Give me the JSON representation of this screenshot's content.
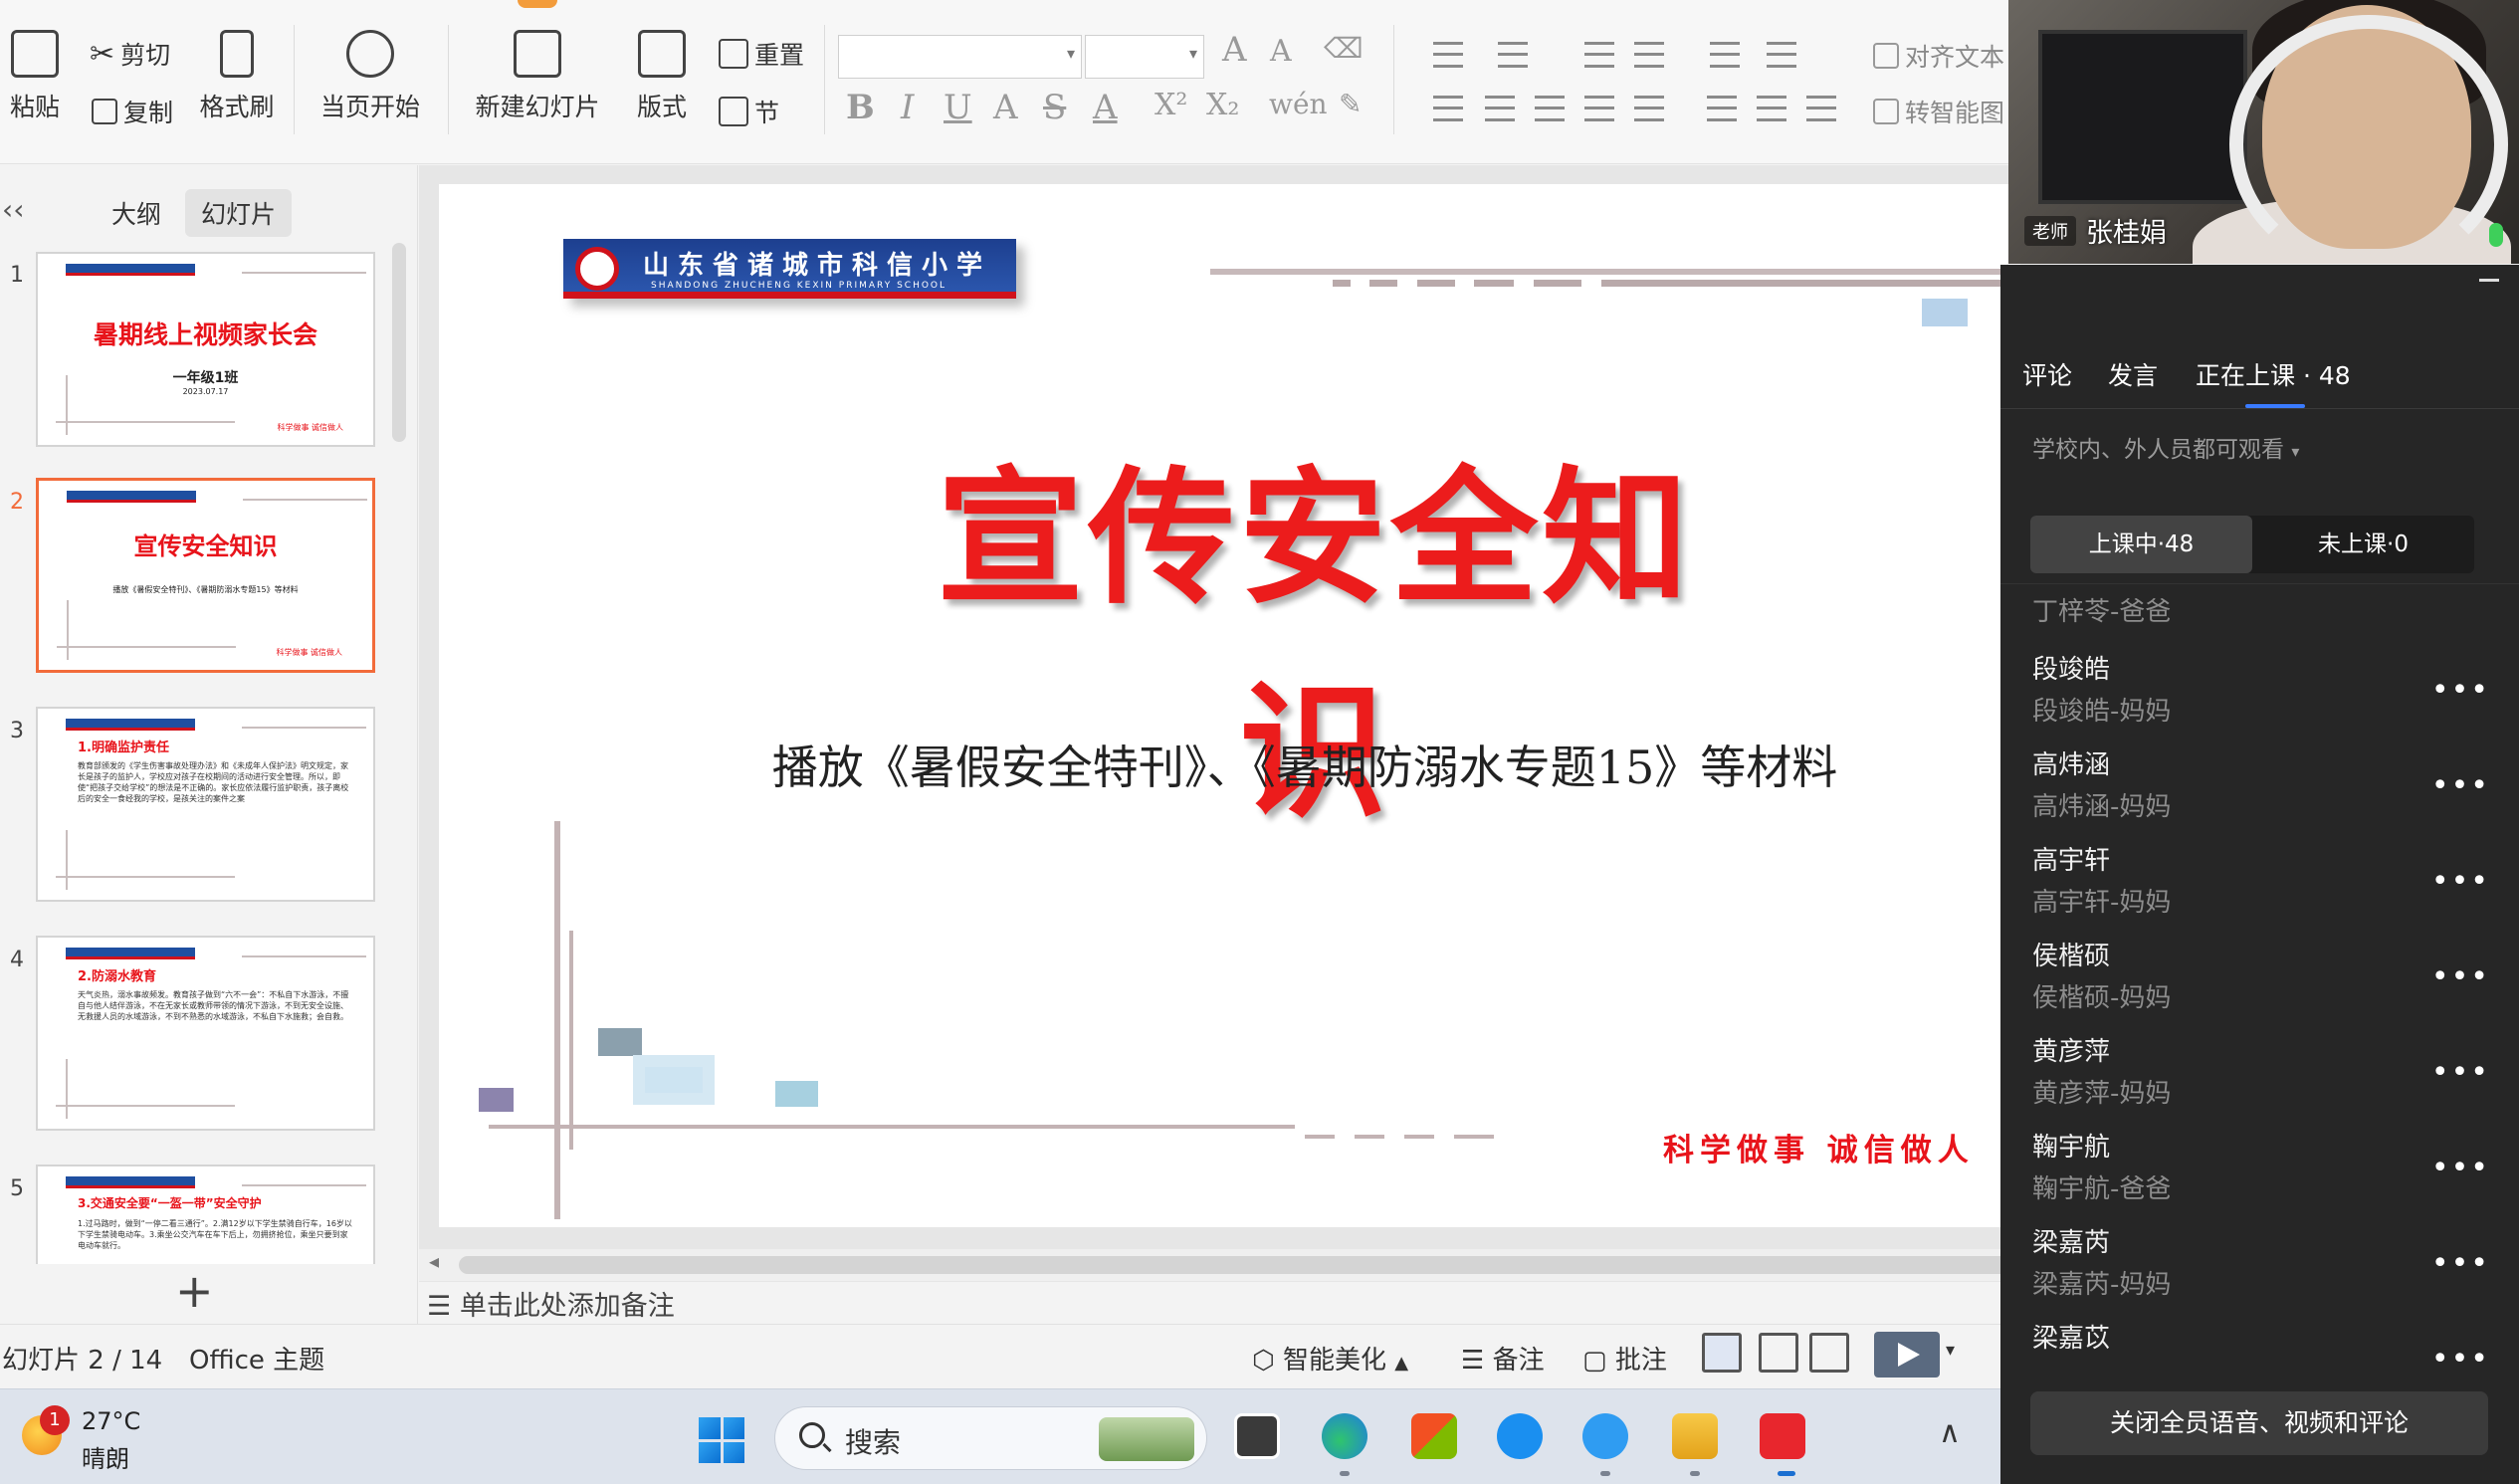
{
  "ribbon": {
    "paste": "粘贴",
    "cut": "剪切",
    "copy": "复制",
    "format_painter": "格式刷",
    "from_current": "当页开始",
    "new_slide": "新建幻灯片",
    "layout": "版式",
    "reset": "重置",
    "section": "节",
    "align_text": "对齐文本",
    "convert_smartart": "转智能图"
  },
  "left_panel": {
    "tab_outline": "大纲",
    "tab_slides": "幻灯片",
    "thumbnails": [
      {
        "num": "1",
        "title": "暑期线上视频家长会",
        "class_name": "一年级1班",
        "date": "2023.07.17",
        "footer": "科学做事  诚信做人"
      },
      {
        "num": "2",
        "title": "宣传安全知识",
        "sub": "播放《暑假安全特刊》、《暑期防溺水专题15》等材料",
        "footer": "科学做事  诚信做人"
      },
      {
        "num": "3",
        "title": "1.明确监护责任",
        "body": "教育部颁发的《学生伤害事故处理办法》和《未成年人保护法》明文规定，家长是孩子的监护人，学校应对孩子在校期间的活动进行安全管理。所以，即使“把孩子交给学校”的想法是不正确的。家长应依法履行监护职责，孩子离校后的安全一食经我的学校，是孩关注的案件之案"
      },
      {
        "num": "4",
        "title": "2.防溺水教育",
        "body": "天气炎热，溺水事故频发。教育孩子做到“六不一会”：不私自下水游泳，不擅自与他人结伴游泳，不在无家长或教师带领的情况下游泳，不到无安全设施、无救援人员的水域游泳，不到不熟悉的水域游泳，不私自下水施救；会自救。"
      },
      {
        "num": "5",
        "title": "3.交通安全要“一盔一带”安全守护",
        "body": "1.过马路时，做到“一停二看三通行”。2.满12岁以下学生禁骑自行车，16岁以下学生禁骑电动车。3.乘坐公交汽车在车下后上，勿拥挤抢位，乘坐只要到家电动车就行。"
      }
    ]
  },
  "slide": {
    "school_name": "山东省诸城市科信小学",
    "school_en": "SHANDONG ZHUCHENG KEXIN PRIMARY SCHOOL",
    "title": "宣传安全知识",
    "subtitle": "播放《暑假安全特刊》、《暑期防溺水专题15》等材料",
    "footer_motto": "科学做事  诚信做人"
  },
  "notes_placeholder": "单击此处添加备注",
  "status": {
    "slide_counter": "幻灯片 2 / 14",
    "theme": "Office 主题",
    "smart_beautify": "智能美化",
    "notes": "备注",
    "comments": "批注"
  },
  "live": {
    "teacher_badge": "老师",
    "teacher_name": "张桂娟",
    "tabs": [
      "评论",
      "发言",
      "正在上课 · 48"
    ],
    "scope": "学校内、外人员都可观看",
    "seg_in_class": "上课中·48",
    "seg_not_in_class": "未上课·0",
    "first_row": "丁梓苓-爸爸",
    "members": [
      {
        "name": "段竣皓",
        "parent": "段竣皓-妈妈"
      },
      {
        "name": "高炜涵",
        "parent": "高炜涵-妈妈"
      },
      {
        "name": "高宇轩",
        "parent": "高宇轩-妈妈"
      },
      {
        "name": "侯楷硕",
        "parent": "侯楷硕-妈妈"
      },
      {
        "name": "黄彦萍",
        "parent": "黄彦萍-妈妈"
      },
      {
        "name": "鞠宇航",
        "parent": "鞠宇航-爸爸"
      },
      {
        "name": "梁嘉芮",
        "parent": "梁嘉芮-妈妈"
      },
      {
        "name": "梁嘉苡",
        "parent": ""
      }
    ],
    "more_label": "•••",
    "mute_all": "关闭全员语音、视频和评论"
  },
  "taskbar": {
    "temperature": "27°C",
    "weather": "晴朗",
    "weather_badge": "1",
    "search": "搜索",
    "tray_chevron": "∧"
  },
  "colors": {
    "accent_orange": "#f26b3a",
    "title_red": "#ec1c1c",
    "live_bg": "#262626",
    "active_tab_underline": "#3a7bff"
  }
}
